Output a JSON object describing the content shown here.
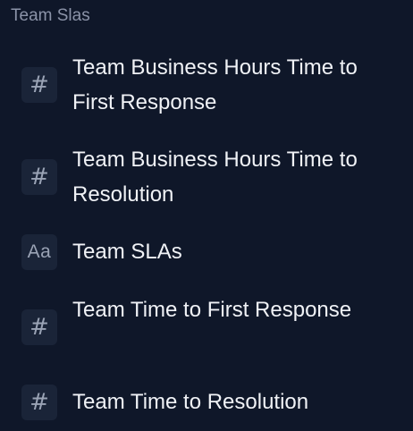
{
  "group": {
    "title": "Team Slas"
  },
  "items": [
    {
      "icon": "hash-icon",
      "glyph": "#",
      "label": "Team Business Hours Time to First Response"
    },
    {
      "icon": "hash-icon",
      "glyph": "#",
      "label": "Team Business Hours Time to Resolution"
    },
    {
      "icon": "text-type-icon",
      "glyph": "Aa",
      "label": "Team SLAs"
    },
    {
      "icon": "hash-icon",
      "glyph": "#",
      "label": "Team Time to First Response"
    },
    {
      "icon": "hash-icon",
      "glyph": "#",
      "label": "Team Time to Resolution"
    }
  ]
}
